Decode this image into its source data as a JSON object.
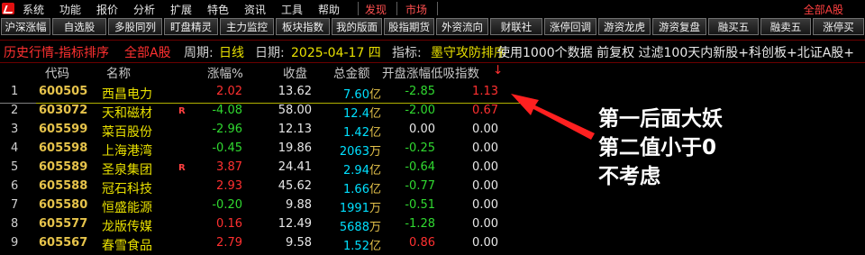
{
  "menubar": {
    "items": [
      "系统",
      "功能",
      "报价",
      "分析",
      "扩展",
      "特色",
      "资讯",
      "工具",
      "帮助"
    ],
    "highlight_items": [
      "发现",
      "市场"
    ],
    "right_label": "全部A股"
  },
  "toolbar": {
    "buttons": [
      "沪深涨幅",
      "自选股",
      "多股同列",
      "盯盘精灵",
      "主力监控",
      "板块指数",
      "我的版面",
      "股指期货",
      "外资流向",
      "财联社",
      "涨停回调",
      "游资龙虎",
      "游资复盘",
      "融买五",
      "融卖五",
      "涨停买"
    ]
  },
  "infobar": {
    "title": "历史行情-指标排序",
    "board": "全部A股",
    "period_label": "周期:",
    "period": "日线",
    "date_label": "日期:",
    "date": "2025-04-17 四",
    "indicator_label": "指标:",
    "indicator": "墨守攻防排序",
    "note": "使用1000个数据 前复权 过滤100天内新股+科创板+北证A股+"
  },
  "table": {
    "headers": {
      "code": "代码",
      "name": "名称",
      "chg": "涨幅%",
      "close": "收盘",
      "amount": "总金额",
      "open_idx": "开盘涨幅低吸指数",
      "sort_icon": "↓"
    },
    "rows": [
      {
        "idx": "1",
        "code": "600505",
        "name": "西昌电力",
        "flag": "",
        "chg": "2.02",
        "close": "13.62",
        "amt": "7.60",
        "amt_unit": "亿",
        "open": "-2.85",
        "val": "1.13"
      },
      {
        "idx": "2",
        "code": "603072",
        "name": "天和磁材",
        "flag": "R",
        "chg": "-4.08",
        "close": "58.00",
        "amt": "12.4",
        "amt_unit": "亿",
        "open": "-2.00",
        "val": "0.67"
      },
      {
        "idx": "3",
        "code": "605599",
        "name": "菜百股份",
        "flag": "",
        "chg": "-2.96",
        "close": "12.13",
        "amt": "1.42",
        "amt_unit": "亿",
        "open": "0.00",
        "val": "0.00"
      },
      {
        "idx": "4",
        "code": "605598",
        "name": "上海港湾",
        "flag": "",
        "chg": "-0.45",
        "close": "19.86",
        "amt": "2063",
        "amt_unit": "万",
        "open": "-0.25",
        "val": "0.00"
      },
      {
        "idx": "5",
        "code": "605589",
        "name": "圣泉集团",
        "flag": "R",
        "chg": "3.87",
        "close": "24.41",
        "amt": "2.94",
        "amt_unit": "亿",
        "open": "-0.64",
        "val": "0.00"
      },
      {
        "idx": "6",
        "code": "605588",
        "name": "冠石科技",
        "flag": "",
        "chg": "2.93",
        "close": "45.62",
        "amt": "1.66",
        "amt_unit": "亿",
        "open": "-0.77",
        "val": "0.00"
      },
      {
        "idx": "7",
        "code": "605580",
        "name": "恒盛能源",
        "flag": "",
        "chg": "-0.20",
        "close": "9.88",
        "amt": "1991",
        "amt_unit": "万",
        "open": "-0.51",
        "val": "0.00"
      },
      {
        "idx": "8",
        "code": "605577",
        "name": "龙版传媒",
        "flag": "",
        "chg": "0.16",
        "close": "12.49",
        "amt": "5688",
        "amt_unit": "万",
        "open": "-1.28",
        "val": "0.00"
      },
      {
        "idx": "9",
        "code": "605567",
        "name": "春雪食品",
        "flag": "",
        "chg": "2.79",
        "close": "9.58",
        "amt": "1.52",
        "amt_unit": "亿",
        "open": "0.86",
        "val": "0.00"
      }
    ]
  },
  "annotation": {
    "lines": [
      "第一后面大妖",
      "第二值小于0",
      "不考虑"
    ]
  },
  "colors": {
    "up": "#ff3030",
    "down": "#30d830",
    "code": "#e6c34b",
    "name": "#e8e000",
    "amount": "#00e0ff",
    "title_red": "#ff3030"
  }
}
